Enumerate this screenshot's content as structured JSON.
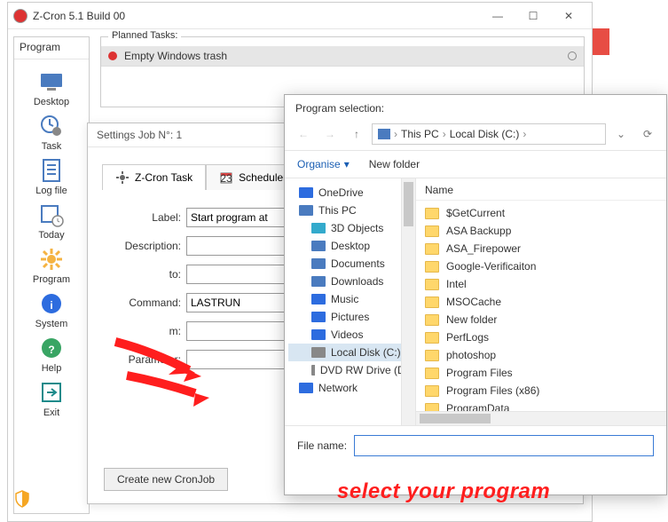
{
  "app": {
    "title": "Z-Cron 5.1 Build 00",
    "sidebar_header": "Program",
    "sidebar": [
      {
        "label": "Desktop"
      },
      {
        "label": "Task"
      },
      {
        "label": "Log file"
      },
      {
        "label": "Today"
      },
      {
        "label": "Program"
      },
      {
        "label": "System"
      },
      {
        "label": "Help"
      },
      {
        "label": "Exit"
      }
    ],
    "planned_title": "Planned Tasks:",
    "planned_task": "Empty Windows trash"
  },
  "settings": {
    "title": "Settings Job N°: 1",
    "tab_task": "Z-Cron Task",
    "tab_scheduler": "Scheduler",
    "labels": {
      "label": "Label:",
      "description": "Description:",
      "to": "to:",
      "command": "Command:",
      "m": "m:",
      "parameter": "Parameter:"
    },
    "values": {
      "label": "Start program at",
      "command": "LASTRUN"
    },
    "buttons": {
      "create": "Create new CronJob"
    }
  },
  "file_dialog": {
    "title": "Program selection:",
    "crumbs": {
      "pc": "This PC",
      "disk": "Local Disk (C:)"
    },
    "toolbar": {
      "organise": "Organise",
      "new_folder": "New folder"
    },
    "tree": [
      {
        "label": "OneDrive",
        "icon": "cloud"
      },
      {
        "label": "This PC",
        "icon": "pc"
      },
      {
        "label": "3D Objects",
        "icon": "3d",
        "sub": true
      },
      {
        "label": "Desktop",
        "icon": "desktop",
        "sub": true
      },
      {
        "label": "Documents",
        "icon": "docs",
        "sub": true
      },
      {
        "label": "Downloads",
        "icon": "down",
        "sub": true
      },
      {
        "label": "Music",
        "icon": "music",
        "sub": true
      },
      {
        "label": "Pictures",
        "icon": "pics",
        "sub": true
      },
      {
        "label": "Videos",
        "icon": "vids",
        "sub": true
      },
      {
        "label": "Local Disk (C:)",
        "icon": "drive",
        "sub": true,
        "selected": true
      },
      {
        "label": "DVD RW Drive (D:)",
        "icon": "dvd",
        "sub": true
      },
      {
        "label": "Network",
        "icon": "net"
      }
    ],
    "list_header": "Name",
    "list": [
      "$GetCurrent",
      "ASA Backupp",
      "ASA_Firepower",
      "Google-Verificaiton",
      "Intel",
      "MSOCache",
      "New folder",
      "PerfLogs",
      "photoshop",
      "Program Files",
      "Program Files (x86)",
      "ProgramData"
    ],
    "filename_label": "File name:"
  },
  "annotation": "select your program"
}
